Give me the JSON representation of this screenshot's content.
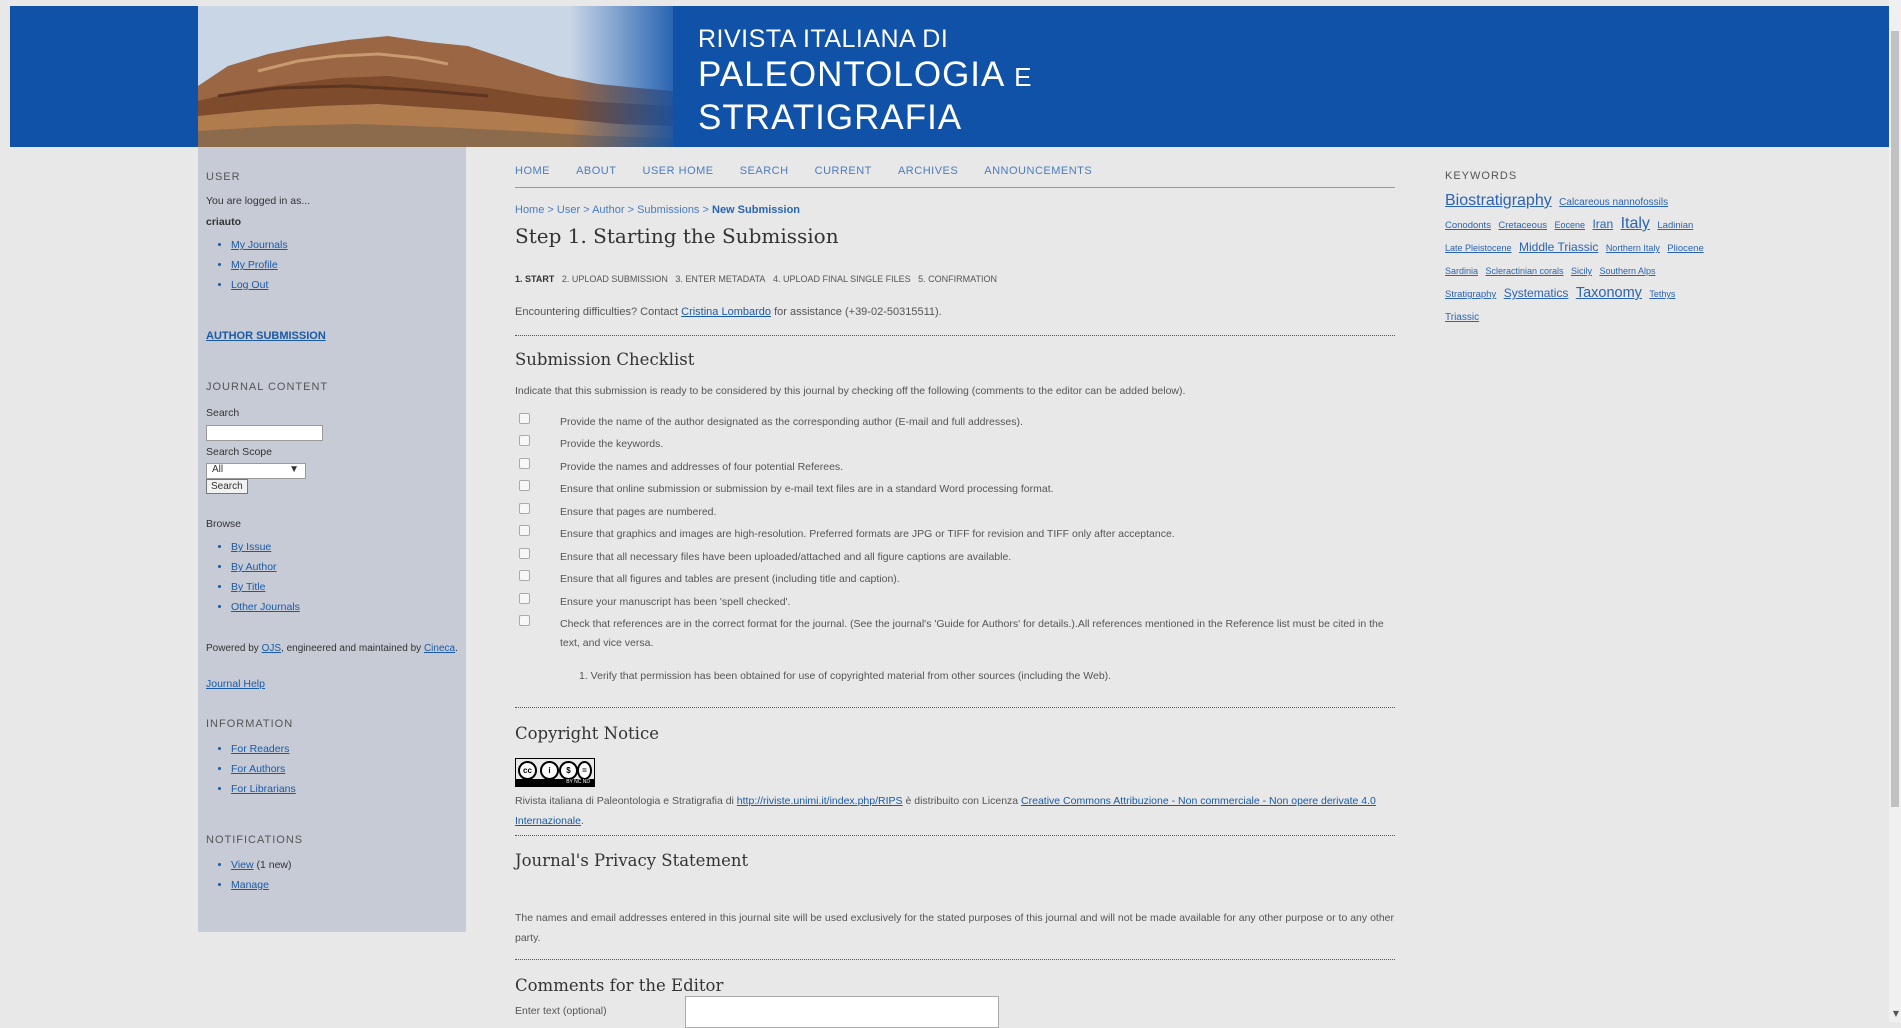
{
  "header": {
    "title_line1": "RIVISTA ITALIANA DI",
    "title_line2": "PALEONTOLOGIA",
    "title_line2_small": "E",
    "title_line3": "STRATIGRAFIA"
  },
  "sidebar": {
    "user_heading": "USER",
    "logged_in_as": "You are logged in as...",
    "username": "criauto",
    "user_links": [
      "My Journals",
      "My Profile",
      "Log Out"
    ],
    "author_submission": "AUTHOR SUBMISSION",
    "journal_content_heading": "JOURNAL CONTENT",
    "search_label": "Search",
    "search_scope_label": "Search Scope",
    "search_scope_value": "All",
    "search_button": "Search",
    "browse_label": "Browse",
    "browse_links": [
      "By Issue",
      "By Author",
      "By Title",
      "Other Journals"
    ],
    "powered_prefix": "Powered by",
    "powered_ojs": "OJS",
    "powered_middle": ", engineered and maintained by",
    "powered_cineca": "Cineca",
    "powered_suffix": ".",
    "journal_help": "Journal Help",
    "information_heading": "INFORMATION",
    "information_links": [
      "For Readers",
      "For Authors",
      "For Librarians"
    ],
    "notifications_heading": "NOTIFICATIONS",
    "notif_view": "View",
    "notif_view_count": "(1 new)",
    "notif_manage": "Manage"
  },
  "nav": {
    "items": [
      "HOME",
      "ABOUT",
      "USER HOME",
      "SEARCH",
      "CURRENT",
      "ARCHIVES",
      "ANNOUNCEMENTS"
    ]
  },
  "breadcrumb": {
    "items": [
      "Home",
      "User",
      "Author",
      "Submissions"
    ],
    "separator": ">",
    "current": "New Submission"
  },
  "main": {
    "step_title": "Step 1. Starting the Submission",
    "steps": [
      "1. START",
      "2. UPLOAD SUBMISSION",
      "3. ENTER METADATA",
      "4. UPLOAD FINAL SINGLE FILES",
      "5. CONFIRMATION"
    ],
    "difficulty_prefix": "Encountering difficulties? Contact",
    "difficulty_contact": "Cristina Lombardo",
    "difficulty_suffix": "for assistance (+39-02-50315511).",
    "checklist_heading": "Submission Checklist",
    "checklist_intro": "Indicate that this submission is ready to be considered by this journal by checking off the following (comments to the editor can be added below).",
    "checklist": [
      "Provide the name of the author designated as the corresponding author (E-mail and full addresses).",
      "Provide the keywords.",
      "Provide the names and addresses of four potential Referees.",
      "Ensure that online submission or submission by e-mail text files are in a standard Word processing format.",
      "Ensure that pages are numbered.",
      "Ensure that graphics and images are high-resolution.    Preferred formats are JPG or TIFF for revision and TIFF only after acceptance.",
      "Ensure that all necessary files have been uploaded/attached and all figure captions are available.",
      "Ensure that all figures and tables are present (including title and caption).",
      "Ensure your manuscript has been 'spell checked'.",
      "Check that references are in the correct format for the journal. (See the journal's 'Guide for Authors' for details.).All references mentioned in the Reference list must be cited in the text, and vice versa."
    ],
    "checklist_subitem": "1.  Verify that permission has been obtained for use of copyrighted material from other sources (including the Web).",
    "copyright_heading": "Copyright Notice",
    "cc_badge_text": "BY NC ND",
    "copyright_prefix": "Rivista italiana di Paleontologia e Stratigrafia di",
    "copyright_url": "http://riviste.unimi.it/index.php/RIPS",
    "copyright_middle": "è distribuito con Licenza",
    "copyright_license": "Creative Commons Attribuzione - Non commerciale - Non opere derivate 4.0 Internazionale",
    "copyright_suffix": ".",
    "privacy_heading": "Journal's Privacy Statement",
    "privacy_text": "The names and email addresses entered in this journal site will be used exclusively for the stated purposes of this journal and will not be made available for any other purpose or to any other party.",
    "comments_heading": "Comments for the Editor",
    "comments_label": "Enter text (optional)"
  },
  "keywords": {
    "heading": "KEYWORDS",
    "cloud": [
      {
        "text": "Biostratigraphy",
        "size": 16
      },
      {
        "text": "Calcareous nannofossils",
        "size": 10
      },
      {
        "text": "Conodonts",
        "size": 9.5
      },
      {
        "text": "Cretaceous",
        "size": 9.5
      },
      {
        "text": "Eocene",
        "size": 9
      },
      {
        "text": "Iran",
        "size": 12
      },
      {
        "text": "Italy",
        "size": 16
      },
      {
        "text": "Ladinian",
        "size": 9.5
      },
      {
        "text": "Late Pleistocene",
        "size": 9
      },
      {
        "text": "Middle Triassic",
        "size": 12
      },
      {
        "text": "Northern Italy",
        "size": 9
      },
      {
        "text": "Pliocene",
        "size": 9.5
      },
      {
        "text": "Sardinia",
        "size": 9
      },
      {
        "text": "Scleractinian corals",
        "size": 9
      },
      {
        "text": "Sicily",
        "size": 9
      },
      {
        "text": "Southern Alps",
        "size": 9
      },
      {
        "text": "Stratigraphy",
        "size": 9.5
      },
      {
        "text": "Systematics",
        "size": 12
      },
      {
        "text": "Taxonomy",
        "size": 14.5
      },
      {
        "text": "Tethys",
        "size": 9
      },
      {
        "text": "Triassic",
        "size": 10
      }
    ]
  }
}
